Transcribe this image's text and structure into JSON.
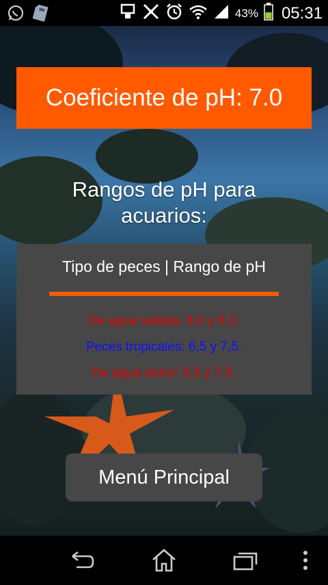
{
  "status_bar": {
    "battery_percent": "43%",
    "time": "05:31",
    "icons": [
      "whatsapp-icon",
      "sd-card-icon",
      "usb-icon",
      "no-signal-tools-icon",
      "alarm-clock-icon",
      "wifi-icon",
      "cell-signal-icon",
      "battery-charging-icon"
    ]
  },
  "main": {
    "ph_title": "Coeficiente de pH: 7.0",
    "ranges_heading": "Rangos de pH para acuarios:",
    "table": {
      "header": "Tipo de peces | Rango de pH",
      "rows": [
        {
          "text": "De agua salada: 8,0 y 8,3.",
          "color": "#e00000"
        },
        {
          "text": "Peces tropicales: 6,5 y 7,5.",
          "color": "#1010ff"
        },
        {
          "text": "De agua dulce: 5,5 y 7,5.",
          "color": "#e00000"
        }
      ]
    },
    "menu_button": "Menú Principal"
  },
  "colors": {
    "accent": "#ff5a00",
    "panel": "#474747"
  },
  "nav_bar": {
    "icons": [
      "back-icon",
      "home-icon",
      "recent-apps-icon",
      "overflow-menu-icon"
    ]
  }
}
